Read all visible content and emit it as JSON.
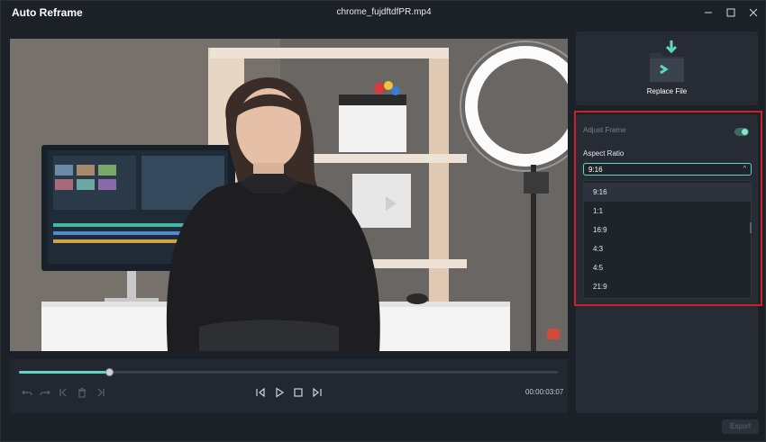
{
  "window": {
    "app_title": "Auto Reframe",
    "file_name": "chrome_fujdftdfPR.mp4",
    "minimize_glyph": "—",
    "maximize_glyph": "☐",
    "close_glyph": "✕"
  },
  "player": {
    "timecode": "00:00:03:07",
    "progress_fraction": 0.168,
    "icons": [
      "undo-icon",
      "redo-icon",
      "prev-keyframe-icon",
      "delete-icon",
      "next-keyframe-icon",
      "step-back-icon",
      "play-icon",
      "stop-icon",
      "step-forward-icon"
    ]
  },
  "right_panel": {
    "replace_file_label": "Replace File",
    "adjust_frame_label": "Adjust Frame",
    "adjust_frame_enabled": true,
    "aspect_ratio_label": "Aspect Ratio",
    "aspect_ratio_selected": "9:16",
    "caret_glyph": "^",
    "aspect_ratio_options": [
      "9:16",
      "1:1",
      "16:9",
      "4:3",
      "4:5",
      "21:9"
    ],
    "export_label": "Export"
  },
  "colors": {
    "accent": "#5fd6c4",
    "highlight_border": "#d11f2a",
    "background": "#1c2027",
    "panel": "#272c34"
  }
}
